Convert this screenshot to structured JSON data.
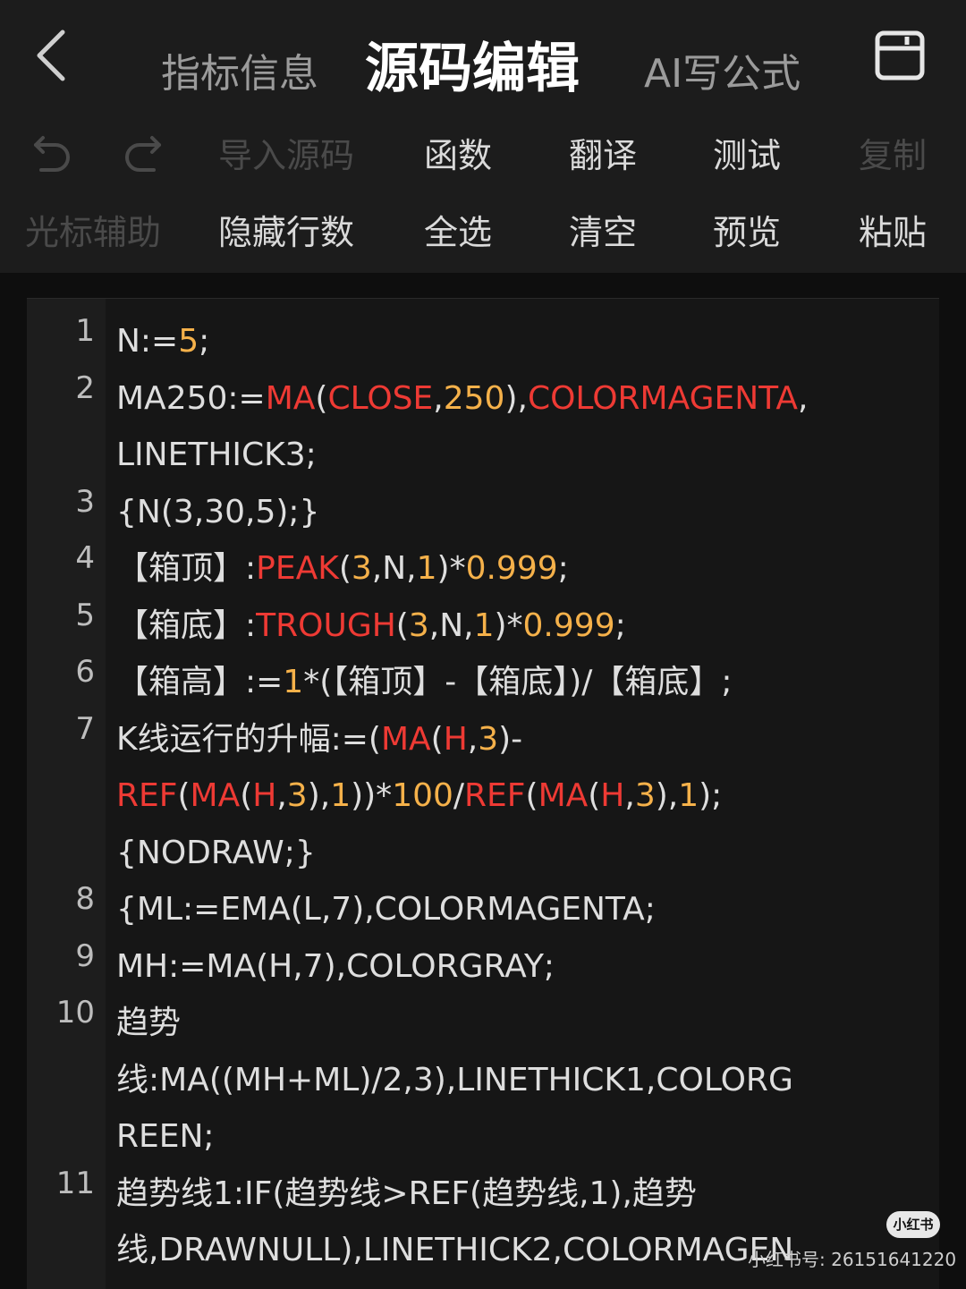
{
  "header": {
    "tab_info": "指标信息",
    "tab_source": "源码编辑",
    "tab_ai": "AI写公式"
  },
  "toolbar": {
    "row1": [
      "导入源码",
      "函数",
      "翻译",
      "测试",
      "复制"
    ],
    "row2": [
      "光标辅助",
      "隐藏行数",
      "全选",
      "清空",
      "预览",
      "粘贴"
    ]
  },
  "colors": {
    "number": "#f5b14a",
    "function": "#ee3a34",
    "text": "#dedede",
    "disabled": "#4a4a4a"
  },
  "code_lines": [
    {
      "n": "1",
      "rows": [
        [
          [
            "t",
            "N:="
          ],
          [
            "n",
            "5"
          ],
          [
            "t",
            ";"
          ]
        ]
      ]
    },
    {
      "n": "2",
      "rows": [
        [
          [
            "t",
            "MA250:="
          ],
          [
            "f",
            "MA"
          ],
          [
            "t",
            "("
          ],
          [
            "f",
            "CLOSE"
          ],
          [
            "t",
            ","
          ],
          [
            "n",
            "250"
          ],
          [
            "t",
            "),"
          ],
          [
            "f",
            "COLORMAGENTA"
          ],
          [
            "t",
            ","
          ]
        ],
        [
          [
            "t",
            "LINETHICK3;"
          ]
        ]
      ]
    },
    {
      "n": "3",
      "rows": [
        [
          [
            "t",
            "{N(3,30,5);}"
          ]
        ]
      ]
    },
    {
      "n": "4",
      "rows": [
        [
          [
            "t",
            "【箱顶】:"
          ],
          [
            "f",
            "PEAK"
          ],
          [
            "t",
            "("
          ],
          [
            "n",
            "3"
          ],
          [
            "t",
            ",N,"
          ],
          [
            "n",
            "1"
          ],
          [
            "t",
            ")*"
          ],
          [
            "n",
            "0.999"
          ],
          [
            "t",
            ";"
          ]
        ]
      ]
    },
    {
      "n": "5",
      "rows": [
        [
          [
            "t",
            "【箱底】:"
          ],
          [
            "f",
            "TROUGH"
          ],
          [
            "t",
            "("
          ],
          [
            "n",
            "3"
          ],
          [
            "t",
            ",N,"
          ],
          [
            "n",
            "1"
          ],
          [
            "t",
            ")*"
          ],
          [
            "n",
            "0.999"
          ],
          [
            "t",
            ";"
          ]
        ]
      ]
    },
    {
      "n": "6",
      "rows": [
        [
          [
            "t",
            "【箱高】:="
          ],
          [
            "n",
            "1"
          ],
          [
            "t",
            "*(【箱顶】-【箱底】)/【箱底】;"
          ]
        ]
      ]
    },
    {
      "n": "7",
      "rows": [
        [
          [
            "t",
            "K线运行的升幅:=("
          ],
          [
            "f",
            "MA"
          ],
          [
            "t",
            "("
          ],
          [
            "f",
            "H"
          ],
          [
            "t",
            ","
          ],
          [
            "n",
            "3"
          ],
          [
            "t",
            ")-"
          ]
        ],
        [
          [
            "f",
            "REF"
          ],
          [
            "t",
            "("
          ],
          [
            "f",
            "MA"
          ],
          [
            "t",
            "("
          ],
          [
            "f",
            "H"
          ],
          [
            "t",
            ","
          ],
          [
            "n",
            "3"
          ],
          [
            "t",
            "),"
          ],
          [
            "n",
            "1"
          ],
          [
            "t",
            "))*"
          ],
          [
            "n",
            "100"
          ],
          [
            "t",
            "/"
          ],
          [
            "f",
            "REF"
          ],
          [
            "t",
            "("
          ],
          [
            "f",
            "MA"
          ],
          [
            "t",
            "("
          ],
          [
            "f",
            "H"
          ],
          [
            "t",
            ","
          ],
          [
            "n",
            "3"
          ],
          [
            "t",
            "),"
          ],
          [
            "n",
            "1"
          ],
          [
            "t",
            ");"
          ]
        ],
        [
          [
            "t",
            "{NODRAW;}"
          ]
        ]
      ]
    },
    {
      "n": "8",
      "rows": [
        [
          [
            "t",
            "{ML:=EMA(L,7),COLORMAGENTA;"
          ]
        ]
      ]
    },
    {
      "n": "9",
      "rows": [
        [
          [
            "t",
            "MH:=MA(H,7),COLORGRAY;"
          ]
        ]
      ]
    },
    {
      "n": "10",
      "rows": [
        [
          [
            "t",
            "趋势"
          ]
        ],
        [
          [
            "t",
            "线:MA((MH+ML)/2,3),LINETHICK1,COLORG"
          ]
        ],
        [
          [
            "t",
            "REEN;"
          ]
        ]
      ]
    },
    {
      "n": "11",
      "rows": [
        [
          [
            "t",
            "趋势线1:IF(趋势线>REF(趋势线,1),趋势"
          ]
        ],
        [
          [
            "t",
            "线,DRAWNULL),LINETHICK2,COLORMAGEN"
          ]
        ]
      ]
    }
  ],
  "watermark": {
    "logo": "小红书",
    "text": "小红书号: 26151641220"
  }
}
